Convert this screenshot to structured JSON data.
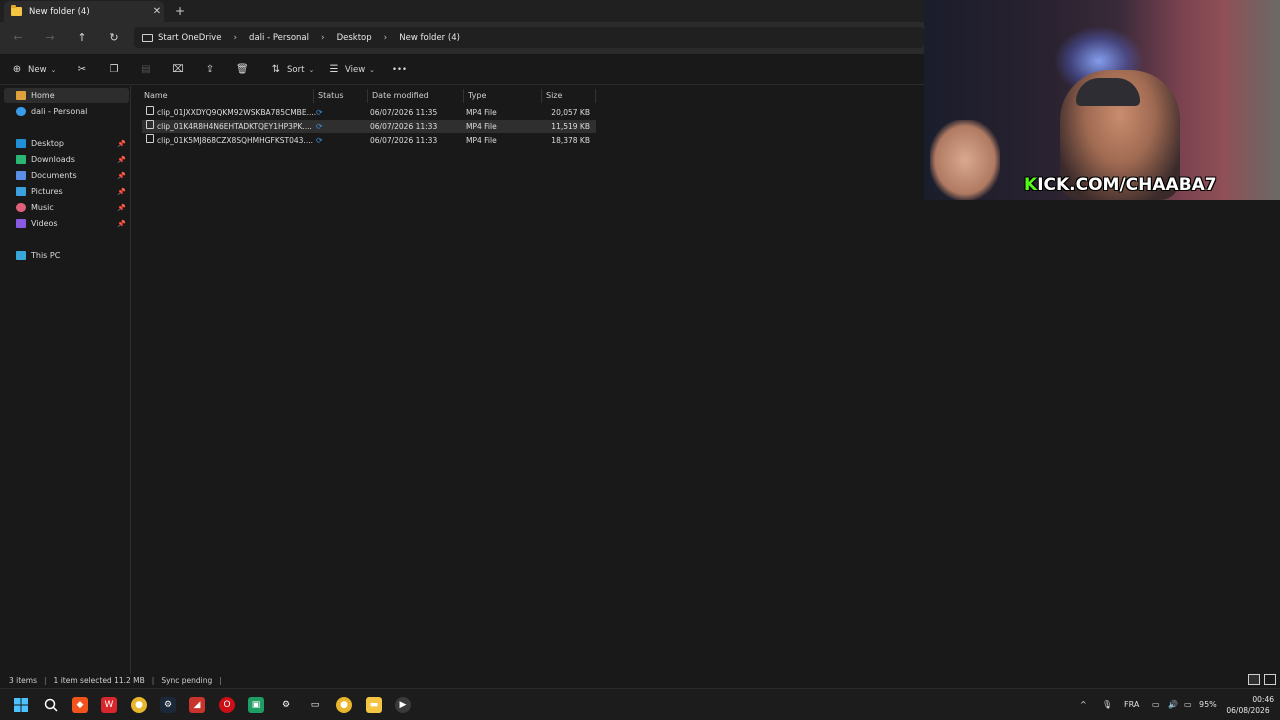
{
  "window": {
    "tab_title": "New folder (4)",
    "close_glyph": "✕",
    "new_tab_glyph": "+"
  },
  "nav": {
    "back": "←",
    "forward": "→",
    "up": "↑",
    "refresh": "↻",
    "breadcrumbs": [
      "Start OneDrive",
      "dali - Personal",
      "Desktop",
      "New folder (4)"
    ],
    "separator": "›"
  },
  "toolbar": {
    "new_label": "New",
    "sort_label": "Sort",
    "view_label": "View",
    "more_glyph": "•••"
  },
  "sidebar": {
    "home": "Home",
    "onedrive": "dali - Personal",
    "items": [
      {
        "label": "Desktop",
        "icon": "desktop-icon",
        "color": "#1f8fd6"
      },
      {
        "label": "Downloads",
        "icon": "downloads-icon",
        "color": "#2bb673"
      },
      {
        "label": "Documents",
        "icon": "documents-icon",
        "color": "#5b8ee6"
      },
      {
        "label": "Pictures",
        "icon": "pictures-icon",
        "color": "#3aa0e0"
      },
      {
        "label": "Music",
        "icon": "music-icon",
        "color": "#e0607a"
      },
      {
        "label": "Videos",
        "icon": "videos-icon",
        "color": "#8a5be0"
      }
    ],
    "this_pc": "This PC"
  },
  "columns": {
    "name": "Name",
    "status": "Status",
    "date": "Date modified",
    "type": "Type",
    "size": "Size"
  },
  "files": [
    {
      "name": "clip_01JXXDYQ9QKM92WSKBA785CMBE....",
      "date": "06/07/2026 11:35",
      "type": "MP4 File",
      "size": "20,057 KB",
      "selected": false
    },
    {
      "name": "clip_01K4R8H4N6EHTADKTQEY1HP3PK....",
      "date": "06/07/2026 11:33",
      "type": "MP4 File",
      "size": "11,519 KB",
      "selected": true
    },
    {
      "name": "clip_01K5MJ868CZX8SQHMHGFKST043....",
      "date": "06/07/2026 11:33",
      "type": "MP4 File",
      "size": "18,378 KB",
      "selected": false
    }
  ],
  "status": {
    "items": "3 items",
    "selected": "1 item selected  11.2 MB",
    "sync": "Sync pending"
  },
  "taskbar": {
    "lang": "FRA",
    "battery": "95%",
    "time": "00:46",
    "date": "06/08/2026"
  },
  "webcam": {
    "banner_k": "K",
    "banner_rest": "ICK.COM/CHAABA7"
  },
  "colors": {
    "accent_sync": "#3a8fd9",
    "kick_green": "#53fc18",
    "folder_yellow": "#f4c542"
  }
}
